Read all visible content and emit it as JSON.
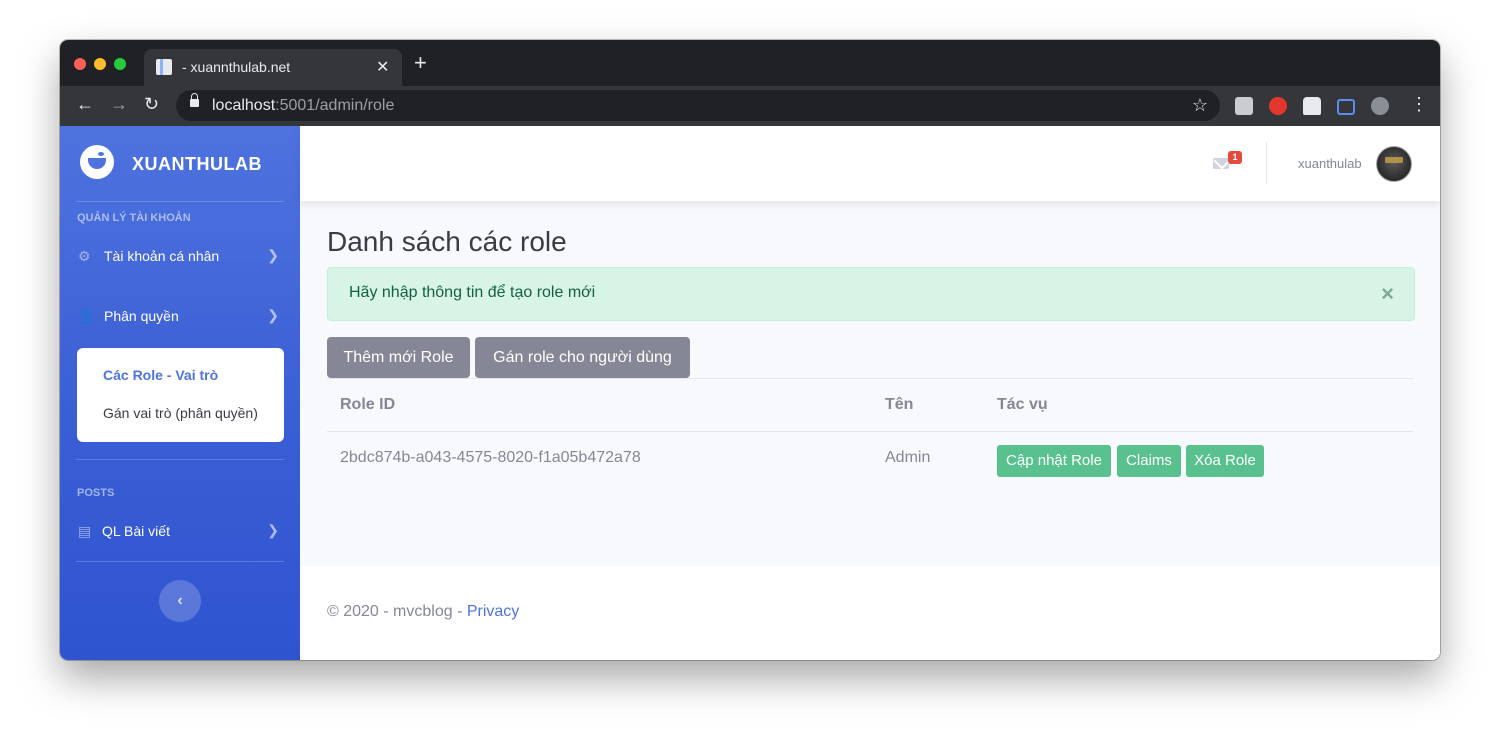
{
  "browser": {
    "tab_title": "- xuannthulab.net",
    "tab_close": "✕",
    "new_tab": "+",
    "url_host": "localhost",
    "url_rest": ":5001/admin/role",
    "nav": {
      "back": "←",
      "forward": "→",
      "reload": "↻",
      "bookmark": "☆",
      "menu": "⋮"
    }
  },
  "sidebar": {
    "brand": "XUANTHULAB",
    "section_account": "QUẢN LÝ TÀI KHOẢN",
    "items": [
      {
        "label": "Tài khoản cá nhân",
        "icon": "gear-icon"
      },
      {
        "label": "Phân quyền",
        "icon": "user-cog-icon"
      }
    ],
    "submenu": [
      {
        "label": "Các Role - Vai trò",
        "active": true
      },
      {
        "label": "Gán vai trò (phân quyền)",
        "active": false
      }
    ],
    "section_posts": "POSTS",
    "posts_item": {
      "label": "QL Bài viết",
      "icon": "list-icon"
    },
    "toggle": "‹"
  },
  "topbar": {
    "message_count": "1",
    "username": "xuanthulab"
  },
  "main": {
    "title": "Danh sách các role",
    "alert": "Hãy nhập thông tin để tạo role mới",
    "alert_close": "×",
    "buttons": {
      "add_role": "Thêm mới Role",
      "assign_role": "Gán role cho người dùng"
    },
    "table": {
      "headers": [
        "Role ID",
        "Tên",
        "Tác vụ"
      ],
      "rows": [
        {
          "id": "2bdc874b-a043-4575-8020-f1a05b472a78",
          "name": "Admin",
          "actions": [
            "Cập nhật Role",
            "Claims",
            "Xóa Role"
          ]
        }
      ]
    }
  },
  "footer": {
    "text": "© 2020 - mvcblog - ",
    "link": "Privacy"
  },
  "colors": {
    "primary": "#4e73df",
    "success": "#59c18e",
    "secondary": "#858796",
    "danger": "#e74a3b"
  }
}
